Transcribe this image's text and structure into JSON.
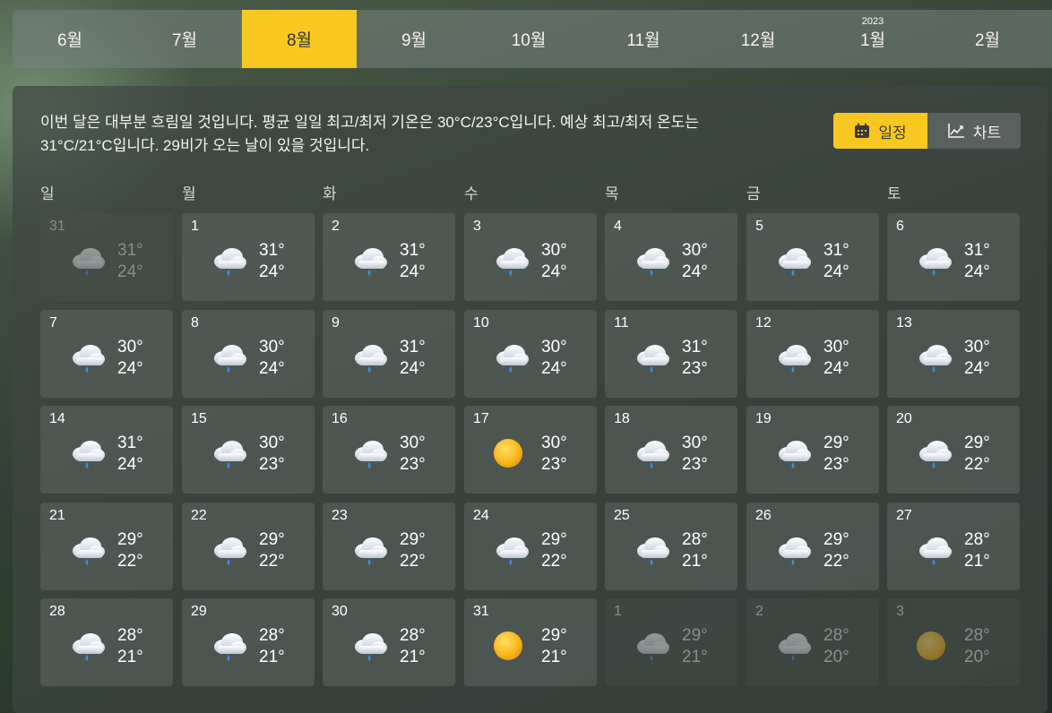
{
  "months": [
    {
      "label": "6월",
      "year": ""
    },
    {
      "label": "7월",
      "year": ""
    },
    {
      "label": "8월",
      "year": "",
      "active": true
    },
    {
      "label": "9월",
      "year": ""
    },
    {
      "label": "10월",
      "year": ""
    },
    {
      "label": "11월",
      "year": ""
    },
    {
      "label": "12월",
      "year": ""
    },
    {
      "label": "1월",
      "year": "2023"
    },
    {
      "label": "2월",
      "year": ""
    }
  ],
  "summary": "이번 달은 대부분 흐림일 것입니다. 평균 일일 최고/최저 기온은 30°C/23°C입니다. 예상 최고/최저 온도는 31°C/21°C입니다. 29비가 오는 날이 있을 것입니다.",
  "view_toggle": {
    "schedule_label": "일정",
    "chart_label": "차트",
    "active": "schedule"
  },
  "weekdays": [
    "일",
    "월",
    "화",
    "수",
    "목",
    "금",
    "토"
  ],
  "days": [
    {
      "day": "31",
      "hi": "31°",
      "lo": "24°",
      "icon": "rain-cloud-icon",
      "dim": true
    },
    {
      "day": "1",
      "hi": "31°",
      "lo": "24°",
      "icon": "rain-cloud-icon"
    },
    {
      "day": "2",
      "hi": "31°",
      "lo": "24°",
      "icon": "rain-cloud-icon"
    },
    {
      "day": "3",
      "hi": "30°",
      "lo": "24°",
      "icon": "rain-cloud-icon"
    },
    {
      "day": "4",
      "hi": "30°",
      "lo": "24°",
      "icon": "rain-cloud-icon"
    },
    {
      "day": "5",
      "hi": "31°",
      "lo": "24°",
      "icon": "rain-cloud-icon"
    },
    {
      "day": "6",
      "hi": "31°",
      "lo": "24°",
      "icon": "rain-cloud-icon"
    },
    {
      "day": "7",
      "hi": "30°",
      "lo": "24°",
      "icon": "rain-cloud-icon"
    },
    {
      "day": "8",
      "hi": "30°",
      "lo": "24°",
      "icon": "rain-cloud-icon"
    },
    {
      "day": "9",
      "hi": "31°",
      "lo": "24°",
      "icon": "rain-cloud-icon"
    },
    {
      "day": "10",
      "hi": "30°",
      "lo": "24°",
      "icon": "rain-cloud-icon"
    },
    {
      "day": "11",
      "hi": "31°",
      "lo": "23°",
      "icon": "rain-cloud-icon"
    },
    {
      "day": "12",
      "hi": "30°",
      "lo": "24°",
      "icon": "rain-cloud-icon"
    },
    {
      "day": "13",
      "hi": "30°",
      "lo": "24°",
      "icon": "rain-cloud-icon"
    },
    {
      "day": "14",
      "hi": "31°",
      "lo": "24°",
      "icon": "rain-cloud-icon"
    },
    {
      "day": "15",
      "hi": "30°",
      "lo": "23°",
      "icon": "rain-cloud-icon"
    },
    {
      "day": "16",
      "hi": "30°",
      "lo": "23°",
      "icon": "rain-cloud-icon"
    },
    {
      "day": "17",
      "hi": "30°",
      "lo": "23°",
      "icon": "sun-icon"
    },
    {
      "day": "18",
      "hi": "30°",
      "lo": "23°",
      "icon": "rain-cloud-icon"
    },
    {
      "day": "19",
      "hi": "29°",
      "lo": "23°",
      "icon": "rain-cloud-icon"
    },
    {
      "day": "20",
      "hi": "29°",
      "lo": "22°",
      "icon": "rain-cloud-icon"
    },
    {
      "day": "21",
      "hi": "29°",
      "lo": "22°",
      "icon": "rain-cloud-icon"
    },
    {
      "day": "22",
      "hi": "29°",
      "lo": "22°",
      "icon": "rain-cloud-icon"
    },
    {
      "day": "23",
      "hi": "29°",
      "lo": "22°",
      "icon": "rain-cloud-icon"
    },
    {
      "day": "24",
      "hi": "29°",
      "lo": "22°",
      "icon": "rain-cloud-icon"
    },
    {
      "day": "25",
      "hi": "28°",
      "lo": "21°",
      "icon": "rain-cloud-icon"
    },
    {
      "day": "26",
      "hi": "29°",
      "lo": "22°",
      "icon": "rain-cloud-icon"
    },
    {
      "day": "27",
      "hi": "28°",
      "lo": "21°",
      "icon": "rain-cloud-icon"
    },
    {
      "day": "28",
      "hi": "28°",
      "lo": "21°",
      "icon": "rain-cloud-icon"
    },
    {
      "day": "29",
      "hi": "28°",
      "lo": "21°",
      "icon": "rain-cloud-icon"
    },
    {
      "day": "30",
      "hi": "28°",
      "lo": "21°",
      "icon": "rain-cloud-icon"
    },
    {
      "day": "31",
      "hi": "29°",
      "lo": "21°",
      "icon": "sun-icon"
    },
    {
      "day": "1",
      "hi": "29°",
      "lo": "21°",
      "icon": "rain-cloud-icon",
      "dim": true
    },
    {
      "day": "2",
      "hi": "28°",
      "lo": "20°",
      "icon": "rain-cloud-icon",
      "dim": true
    },
    {
      "day": "3",
      "hi": "28°",
      "lo": "20°",
      "icon": "sun-icon",
      "dim": true
    }
  ],
  "colors": {
    "accent": "#f8c820",
    "panel": "#3e4642"
  }
}
